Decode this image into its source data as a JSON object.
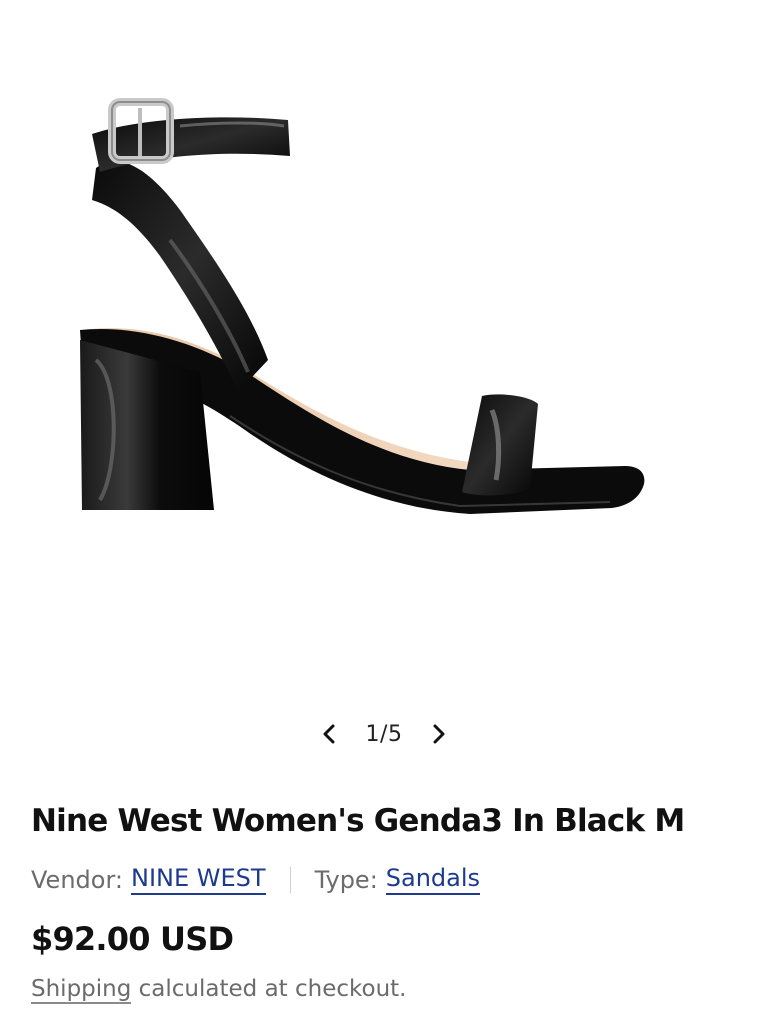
{
  "gallery": {
    "image_alt": "Black patent ankle-strap block heel sandal",
    "current": "1",
    "total": "5",
    "counter_text": "1/5",
    "prev_icon": "chevron-left-icon",
    "next_icon": "chevron-right-icon"
  },
  "product": {
    "title": "Nine West Women's Genda3 In Black M",
    "vendor_label": "Vendor:",
    "vendor_value": "NINE WEST",
    "type_label": "Type:",
    "type_value": "Sandals",
    "price": "$92.00 USD",
    "shipping_link": "Shipping",
    "shipping_text": " calculated at checkout."
  },
  "colors": {
    "link": "#1d3a8f",
    "muted_text": "#6b6b6b",
    "primary_text": "#111111"
  }
}
